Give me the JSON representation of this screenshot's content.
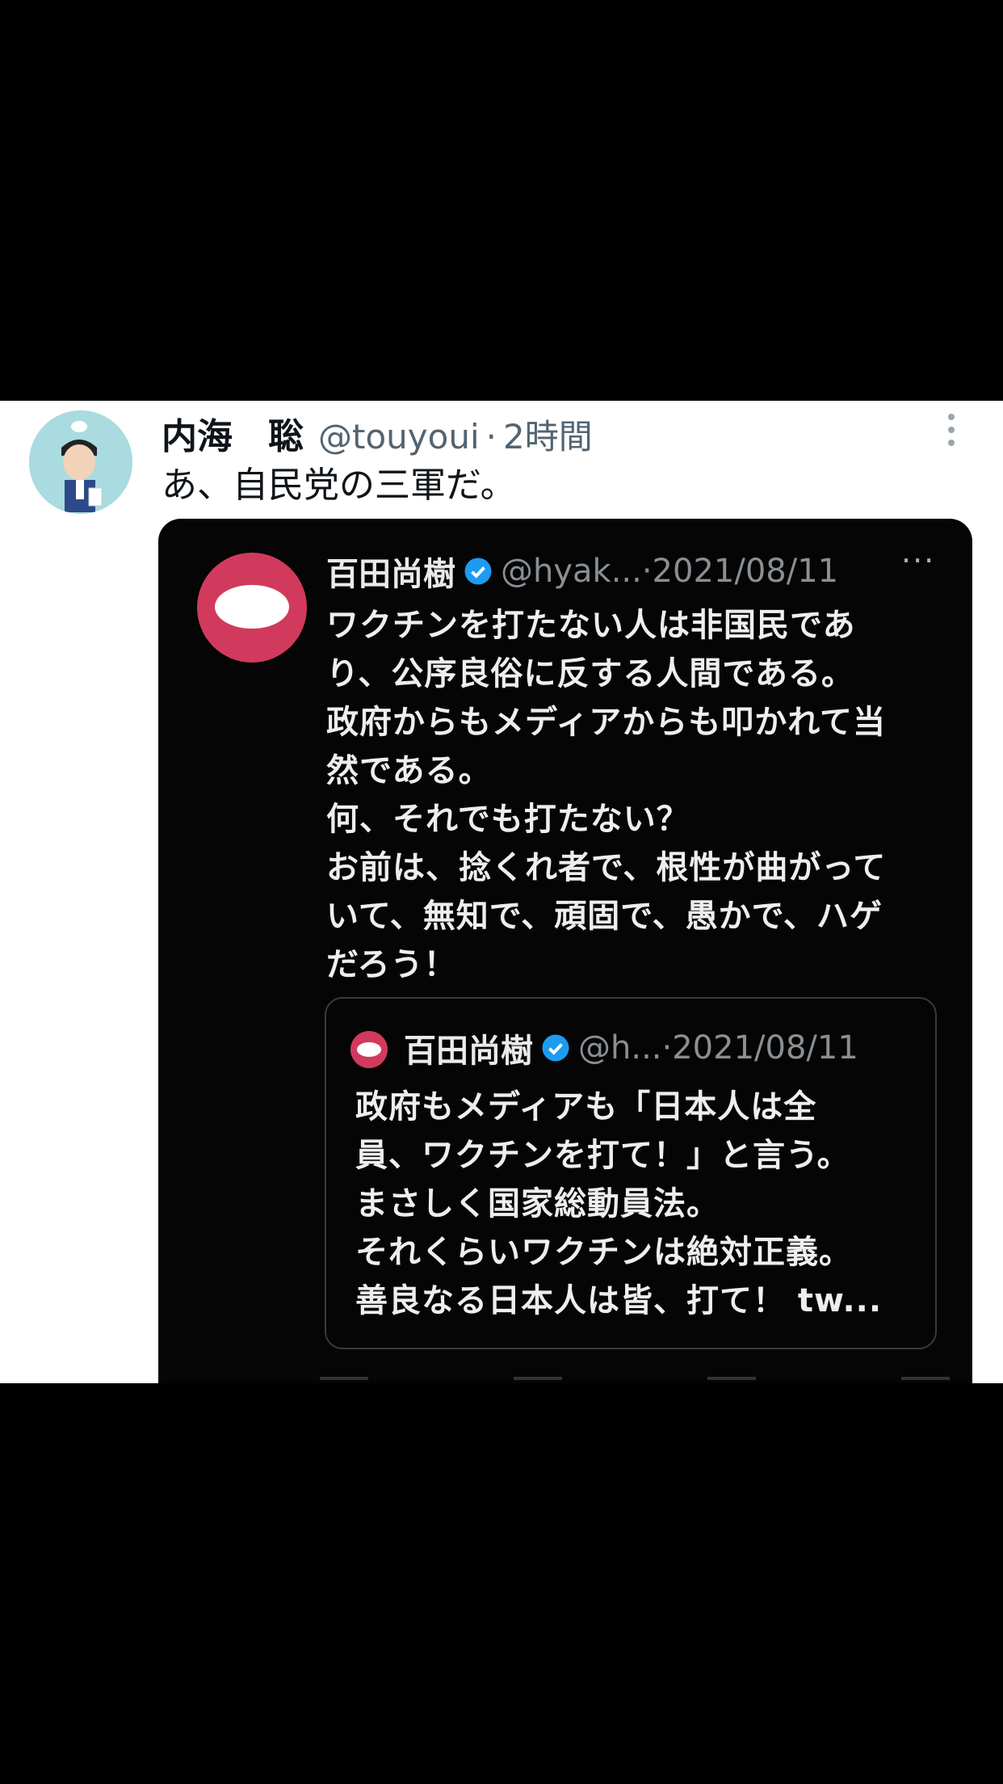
{
  "tweet": {
    "author_name": "内海　聡",
    "handle": "@touyoui",
    "separator": "·",
    "time": "2時間",
    "text": "あ、自民党の三軍だ。"
  },
  "quoted_screenshot": {
    "author_name": "百田尚樹",
    "handle": "@hyak...",
    "date": "·2021/08/11",
    "more": "···",
    "lines": [
      "ワクチンを打たない人は非国民であ",
      "り、公序良俗に反する人間である。",
      "政府からもメディアからも叩かれて当",
      "然である。",
      "何、それでも打たない？",
      "お前は、捻くれ者で、根性が曲がって",
      "いて、無知で、頑固で、愚かで、ハゲ",
      "だろう！"
    ],
    "inner_quote": {
      "author_name": "百田尚樹",
      "handle": "@h...",
      "date": "·2021/08/11",
      "lines": [
        "政府もメディアも「日本人は全",
        "員、ワクチンを打て！」と言う。",
        "まさしく国家総動員法。",
        "それくらいワクチンは絶対正義。",
        "善良なる日本人は皆、打て！ tw..."
      ]
    }
  },
  "colors": {
    "background": "#000000",
    "card": "#ffffff",
    "avatar_bg": "#a9dbe0",
    "quoted_avatar": "#d13a5d",
    "verified": "#1d9bf0"
  }
}
